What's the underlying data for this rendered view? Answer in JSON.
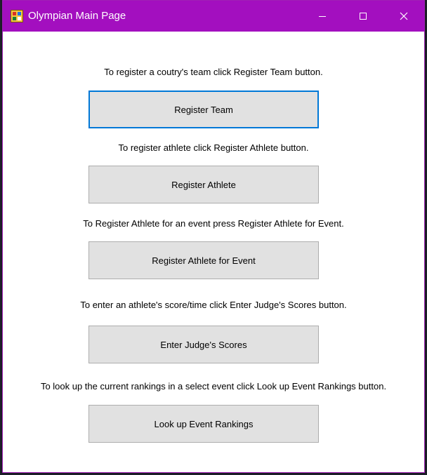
{
  "window": {
    "title": "Olympian Main Page",
    "titlebar_color": "#a30fbf",
    "icons": {
      "app": "app-window-icon",
      "minimize": "minimize-icon",
      "maximize": "maximize-icon",
      "close": "close-icon"
    }
  },
  "sections": [
    {
      "instruction": "To register a coutry's team click Register Team button.",
      "button": "Register Team",
      "focused": true
    },
    {
      "instruction": "To register athlete click Register Athlete button.",
      "button": "Register Athlete",
      "focused": false
    },
    {
      "instruction": "To Register Athlete for an event press Register Athlete for Event.",
      "button": "Register Athlete for Event",
      "focused": false
    },
    {
      "instruction": "To enter an athlete's score/time click Enter Judge's Scores button.",
      "button": "Enter Judge's Scores",
      "focused": false
    },
    {
      "instruction": "To look up the current rankings in a select event click Look up Event Rankings button.",
      "button": "Look up Event Rankings",
      "focused": false
    }
  ],
  "colors": {
    "button_bg": "#e1e1e1",
    "button_border": "#adadad",
    "focus_border": "#0078d7"
  }
}
